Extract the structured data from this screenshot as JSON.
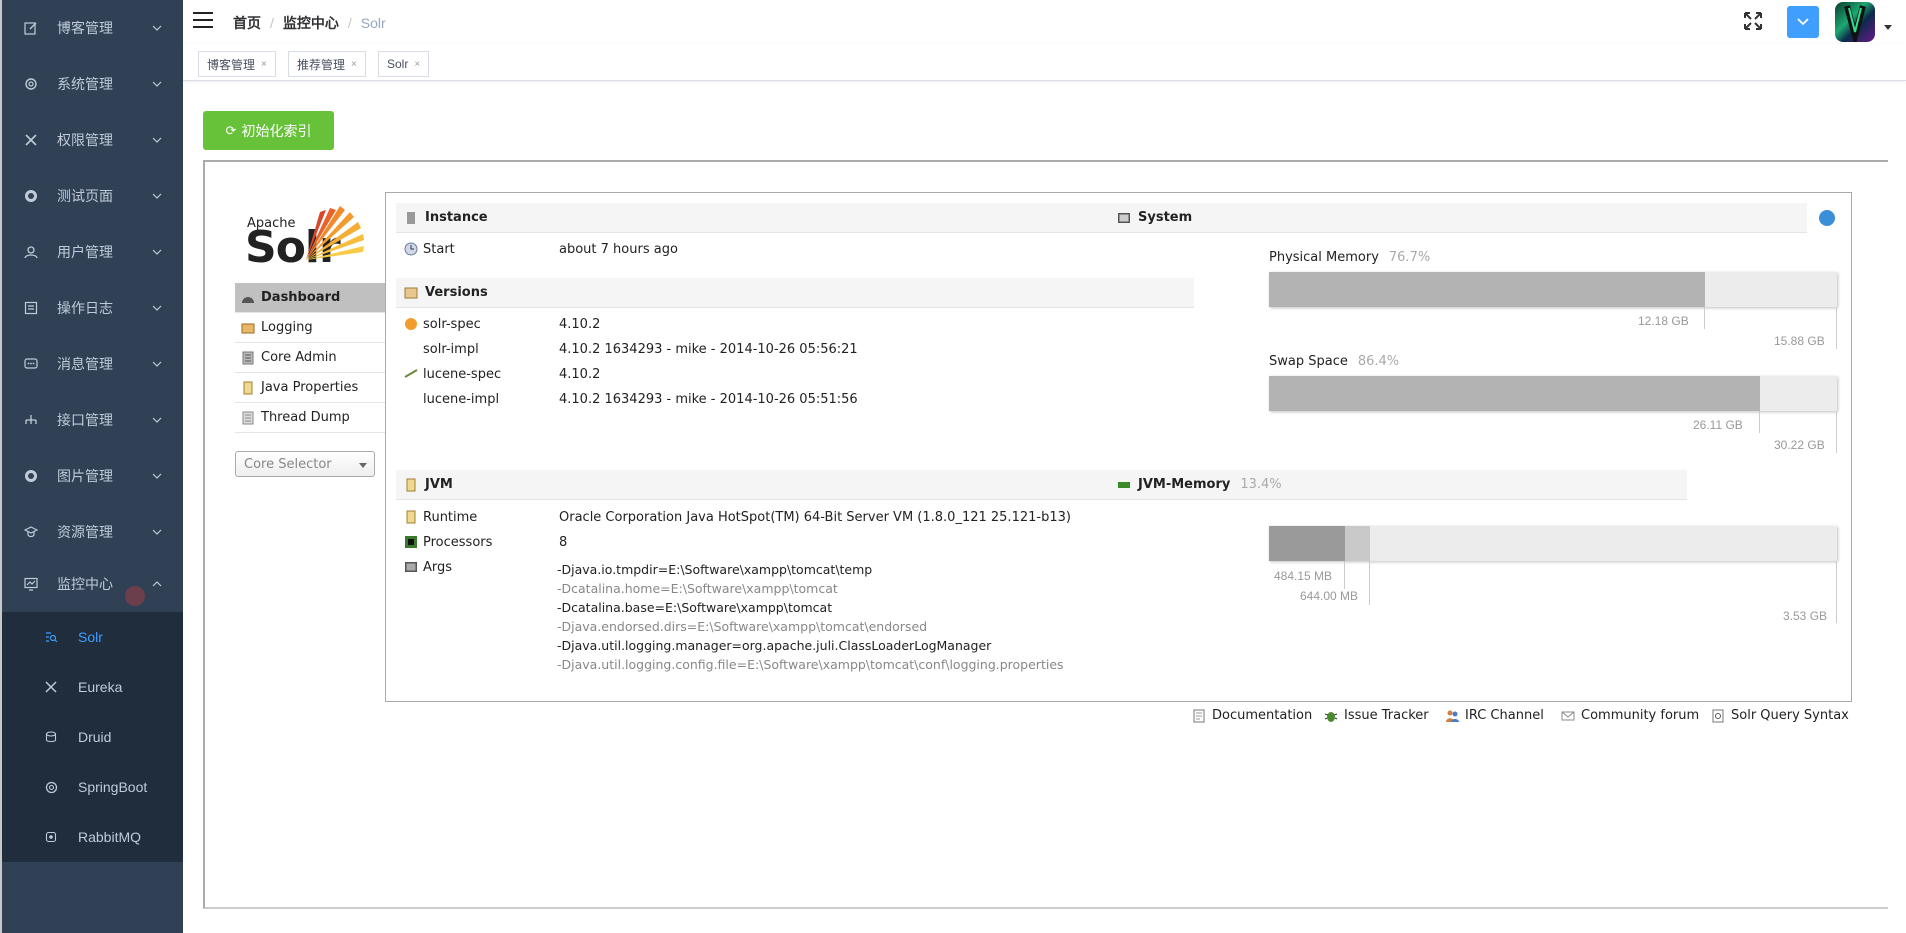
{
  "sidebar": {
    "menu": [
      {
        "label": "博客管理",
        "icon": "edit-icon"
      },
      {
        "label": "系统管理",
        "icon": "gear-icon"
      },
      {
        "label": "权限管理",
        "icon": "tools-icon"
      },
      {
        "label": "测试页面",
        "icon": "target-icon"
      },
      {
        "label": "用户管理",
        "icon": "user-icon"
      },
      {
        "label": "操作日志",
        "icon": "log-icon"
      },
      {
        "label": "消息管理",
        "icon": "message-icon"
      },
      {
        "label": "接口管理",
        "icon": "tree-icon"
      },
      {
        "label": "图片管理",
        "icon": "target-icon"
      },
      {
        "label": "资源管理",
        "icon": "graduation-icon"
      },
      {
        "label": "监控中心",
        "icon": "monitor-icon"
      }
    ],
    "submenu": [
      {
        "label": "Solr",
        "icon": "search-list-icon",
        "active": true
      },
      {
        "label": "Eureka",
        "icon": "tools-icon",
        "active": false
      },
      {
        "label": "Druid",
        "icon": "db-icon",
        "active": false
      },
      {
        "label": "SpringBoot",
        "icon": "gear-icon",
        "active": false
      },
      {
        "label": "RabbitMQ",
        "icon": "rabbit-icon",
        "active": false
      }
    ]
  },
  "breadcrumb": [
    "首页",
    "监控中心",
    "Solr"
  ],
  "tags": [
    "博客管理",
    "推荐管理",
    "Solr"
  ],
  "tag_close": "×",
  "actions": {
    "init_index": "初始化索引"
  },
  "solr": {
    "logo_apache": "Apache",
    "logo_solr": "Solr",
    "nav": [
      "Dashboard",
      "Logging",
      "Core Admin",
      "Java Properties",
      "Thread Dump"
    ],
    "core_selector": "Core Selector",
    "instance": {
      "title": "Instance",
      "start_label": "Start",
      "start_value": "about 7 hours ago"
    },
    "versions": {
      "title": "Versions",
      "rows": [
        {
          "label": "solr-spec",
          "value": "4.10.2"
        },
        {
          "label": "solr-impl",
          "value": "4.10.2 1634293 - mike - 2014-10-26 05:56:21"
        },
        {
          "label": "lucene-spec",
          "value": "4.10.2"
        },
        {
          "label": "lucene-impl",
          "value": "4.10.2 1634293 - mike - 2014-10-26 05:51:56"
        }
      ]
    },
    "jvm": {
      "title": "JVM",
      "runtime_label": "Runtime",
      "runtime_value": "Oracle Corporation Java HotSpot(TM) 64-Bit Server VM (1.8.0_121 25.121-b13)",
      "processors_label": "Processors",
      "processors_value": "8",
      "args_label": "Args",
      "args": [
        "-Djava.io.tmpdir=E:\\Software\\xampp\\tomcat\\temp",
        "-Dcatalina.home=E:\\Software\\xampp\\tomcat",
        "-Dcatalina.base=E:\\Software\\xampp\\tomcat",
        "-Djava.endorsed.dirs=E:\\Software\\xampp\\tomcat\\endorsed",
        "-Djava.util.logging.manager=org.apache.juli.ClassLoaderLogManager",
        "-Djava.util.logging.config.file=E:\\Software\\xampp\\tomcat\\conf\\logging.properties"
      ]
    },
    "system": {
      "title": "System",
      "physical": {
        "label": "Physical Memory",
        "pct": "76.7%",
        "used": "12.18 GB",
        "total": "15.88 GB",
        "fraction": 0.767
      },
      "swap": {
        "label": "Swap Space",
        "pct": "86.4%",
        "used": "26.11 GB",
        "total": "30.22 GB",
        "fraction": 0.864
      }
    },
    "jvm_memory": {
      "title": "JVM-Memory",
      "pct": "13.4%",
      "used": "484.15 MB",
      "committed": "644.00 MB",
      "max": "3.53 GB",
      "used_fraction": 0.134,
      "committed_fraction": 0.178
    },
    "footer": [
      "Documentation",
      "Issue Tracker",
      "IRC Channel",
      "Community forum",
      "Solr Query Syntax"
    ]
  },
  "colors": {
    "sidebar": "#304156",
    "submenu": "#1f2d3d",
    "accent": "#409eff",
    "green": "#67c23a"
  }
}
